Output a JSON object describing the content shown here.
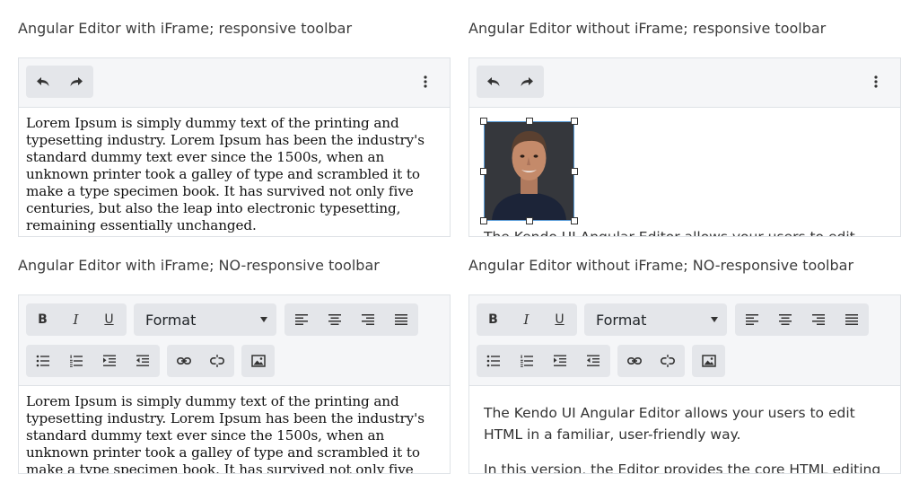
{
  "sections": {
    "iframe_responsive": {
      "title": "Angular Editor with iFrame; responsive toolbar",
      "content": "Lorem Ipsum is simply dummy text of the printing and typesetting industry. Lorem Ipsum has been the industry's standard dummy text ever since the 1500s, when an unknown printer took a galley of type and scrambled it to make a type specimen book. It has survived not only five centuries, but also the leap into electronic typesetting, remaining essentially unchanged."
    },
    "noiframe_responsive": {
      "title": "Angular Editor without iFrame; responsive toolbar",
      "content": "The Kendo UI Angular Editor allows your users to edit HTML in a familiar, user-friendly way."
    },
    "iframe_nonresponsive": {
      "title": "Angular Editor with iFrame; NO-responsive toolbar",
      "content": "Lorem Ipsum is simply dummy text of the printing and typesetting industry. Lorem Ipsum has been the industry's standard dummy text ever since the 1500s, when an unknown printer took a galley of type and scrambled it to make a type specimen book. It has survived not only five centuries, but also the leap into electronic typesetting, remaining essentially unchanged."
    },
    "noiframe_nonresponsive": {
      "title": "Angular Editor without iFrame; NO-responsive toolbar",
      "paragraph1": "The Kendo UI Angular Editor allows your users to edit HTML in a familiar, user-friendly way.",
      "paragraph2": "In this version, the Editor provides the core HTML editing engine."
    }
  },
  "toolbar": {
    "bold": "B",
    "italic": "I",
    "underline": "U",
    "format_select": "Format"
  },
  "icons": [
    "undo-icon",
    "redo-icon",
    "more-vertical-icon",
    "align-left-icon",
    "align-center-icon",
    "align-right-icon",
    "align-justify-icon",
    "bullet-list-icon",
    "numbered-list-icon",
    "indent-icon",
    "outdent-icon",
    "link-icon",
    "unlink-icon",
    "image-icon"
  ],
  "colors": {
    "toolbar_bg": "#f5f6f8",
    "button_group_bg": "#e4e6ea",
    "border": "#dee2e6",
    "selection": "#5b9dd9"
  }
}
